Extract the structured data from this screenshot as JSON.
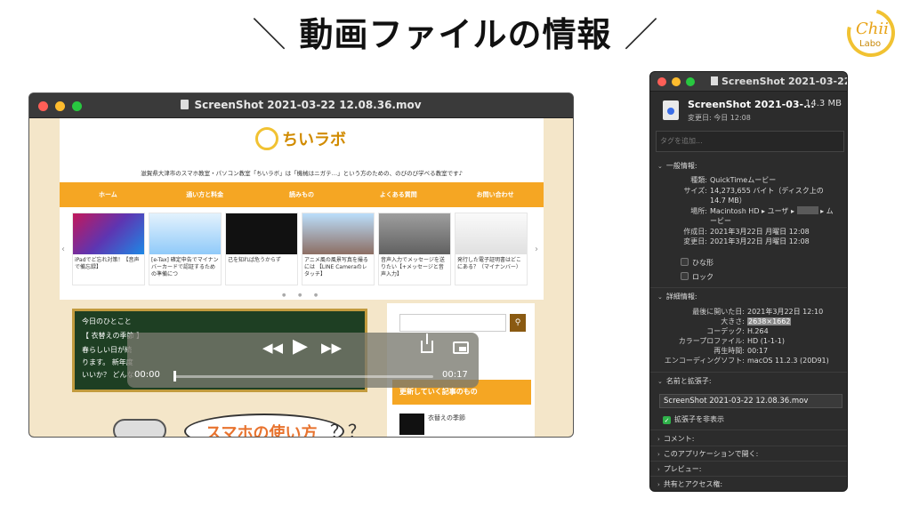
{
  "heading": {
    "left_slash": "＼",
    "title": "動画ファイルの情報",
    "right_slash": "／"
  },
  "logo": {
    "chii": "Chii",
    "labo": "Labo"
  },
  "player": {
    "window_title": "ScreenShot 2021-03-22 12.08.36.mov",
    "site": {
      "logo_text": "ちいラボ",
      "tagline": "滋賀県大津市のスマホ教室・パソコン教室「ちいラボ」は「機械はニガテ…」という方のための、のびのび学べる教室です♪",
      "nav": [
        "ホーム",
        "通い方と料金",
        "読みもの",
        "よくある質問",
        "お問い合わせ"
      ],
      "cards": [
        "iPadでど忘れ対策！【音声で備忘録】",
        "[e-Tax] 確定申告でマイナンバーカードで認証するための準備につ",
        "己を知れば危うからず",
        "アニメ風の風景写真を撮るには 【LINE Cameraのレタッチ】",
        "音声入力でメッセージを送りたい【+メッセージと音声入力】",
        "発行した電子証明書はどこにある？（マイナンバー）"
      ],
      "board": {
        "line1": "今日のひとこと",
        "line2": "【 衣替えの季節 】",
        "line3": "春らしい日が続",
        "line4": "ります。 新年度",
        "line5": "いいか？ どんな"
      },
      "popular_heading": "更新していく記事のもの",
      "popular_item": "衣替えの季節",
      "manga_text": "スマホの使い方",
      "manga_qq": "？？"
    },
    "controls": {
      "time_current": "00:00",
      "time_total": "00:17",
      "progress": 0.0
    }
  },
  "info": {
    "window_title": "ScreenShot 2021-03-22...",
    "file_name": "ScreenShot 2021-03-...",
    "file_size": "14.3 MB",
    "modified_short": "変更日: 今日 12:08",
    "tags_placeholder": "タグを追加...",
    "general": {
      "heading": "一般情報:",
      "kind_k": "種類:",
      "kind_v": "QuickTimeムービー",
      "size_k": "サイズ:",
      "size_v1": "14,273,655 バイト（ディスク上の",
      "size_v2": "14.7 MB）",
      "where_k": "場所:",
      "where_v1": "Macintosh HD ▸ ユーザ ▸",
      "where_v2": "▸ ム",
      "where_v3": "ービー",
      "created_k": "作成日:",
      "created_v": "2021年3月22日 月曜日 12:08",
      "modified_k": "変更日:",
      "modified_v": "2021年3月22日 月曜日 12:08",
      "stationery": "ひな形",
      "locked": "ロック"
    },
    "more": {
      "heading": "詳細情報:",
      "last_opened_k": "最後に開いた日:",
      "last_opened_v": "2021年3月22日 12:10",
      "dimensions_k": "大きさ:",
      "dimensions_v": "2638×1662",
      "codecs_k": "コーデック:",
      "codecs_v": "H.264",
      "color_k": "カラープロファイル:",
      "color_v": "HD (1-1-1)",
      "duration_k": "再生時間:",
      "duration_v": "00:17",
      "encoder_k": "エンコーディングソフト:",
      "encoder_v": "macOS 11.2.3 (20D91)"
    },
    "name_ext": {
      "heading": "名前と拡張子:",
      "value": "ScreenShot 2021-03-22 12.08.36.mov",
      "hide_ext": "拡張子を非表示"
    },
    "sections": [
      "コメント:",
      "このアプリケーションで開く:",
      "プレビュー:",
      "共有とアクセス権:"
    ]
  }
}
